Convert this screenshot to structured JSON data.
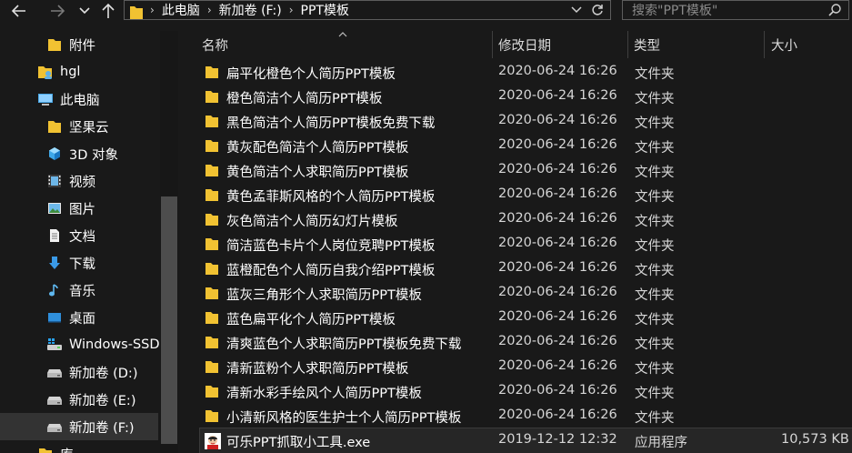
{
  "toolbar": {
    "back_icon": "arrow-left-icon",
    "forward_icon": "arrow-right-icon",
    "recent_icon": "chevron-down-icon",
    "up_icon": "arrow-up-icon",
    "breadcrumbs": [
      "此电脑",
      "新加卷 (F:)",
      "PPT模板"
    ],
    "search_placeholder": "搜索\"PPT模板\""
  },
  "nav": {
    "items": [
      {
        "label": "附件",
        "icon": "folder-icon",
        "pinned": true
      },
      {
        "label": "hgl",
        "icon": "user-folder-icon",
        "pinned": false
      },
      {
        "label": "此电脑",
        "icon": "computer-icon",
        "pinned": false
      },
      {
        "label": "坚果云",
        "icon": "folder-icon",
        "pinned": false
      },
      {
        "label": "3D 对象",
        "icon": "cube-icon",
        "pinned": false
      },
      {
        "label": "视频",
        "icon": "video-icon",
        "pinned": false
      },
      {
        "label": "图片",
        "icon": "picture-icon",
        "pinned": false
      },
      {
        "label": "文档",
        "icon": "document-icon",
        "pinned": false
      },
      {
        "label": "下载",
        "icon": "download-icon",
        "pinned": false
      },
      {
        "label": "音乐",
        "icon": "music-icon",
        "pinned": false
      },
      {
        "label": "桌面",
        "icon": "desktop-icon",
        "pinned": false
      },
      {
        "label": "Windows-SSD",
        "icon": "windows-drive-icon",
        "pinned": false
      },
      {
        "label": "新加卷 (D:)",
        "icon": "drive-icon",
        "pinned": false
      },
      {
        "label": "新加卷 (E:)",
        "icon": "drive-icon",
        "pinned": false
      },
      {
        "label": "新加卷 (F:)",
        "icon": "drive-icon",
        "pinned": false,
        "selected": true
      },
      {
        "label": "库",
        "icon": "folder-icon",
        "pinned": false
      }
    ]
  },
  "columns": {
    "name": "名称",
    "date": "修改日期",
    "type": "类型",
    "size": "大小"
  },
  "files": [
    {
      "name": "扁平化橙色个人简历PPT模板",
      "date": "2020-06-24 16:26",
      "type": "文件夹",
      "size": ""
    },
    {
      "name": "橙色简洁个人简历PPT模板",
      "date": "2020-06-24 16:26",
      "type": "文件夹",
      "size": ""
    },
    {
      "name": "黑色简洁个人简历PPT模板免费下载",
      "date": "2020-06-24 16:26",
      "type": "文件夹",
      "size": ""
    },
    {
      "name": "黄灰配色简洁个人简历PPT模板",
      "date": "2020-06-24 16:26",
      "type": "文件夹",
      "size": ""
    },
    {
      "name": "黄色简洁个人求职简历PPT模板",
      "date": "2020-06-24 16:26",
      "type": "文件夹",
      "size": ""
    },
    {
      "name": "黄色孟菲斯风格的个人简历PPT模板",
      "date": "2020-06-24 16:26",
      "type": "文件夹",
      "size": ""
    },
    {
      "name": "灰色简洁个人简历幻灯片模板",
      "date": "2020-06-24 16:26",
      "type": "文件夹",
      "size": ""
    },
    {
      "name": "简洁蓝色卡片个人岗位竞聘PPT模板",
      "date": "2020-06-24 16:26",
      "type": "文件夹",
      "size": ""
    },
    {
      "name": "蓝橙配色个人简历自我介绍PPT模板",
      "date": "2020-06-24 16:26",
      "type": "文件夹",
      "size": ""
    },
    {
      "name": "蓝灰三角形个人求职简历PPT模板",
      "date": "2020-06-24 16:26",
      "type": "文件夹",
      "size": ""
    },
    {
      "name": "蓝色扁平化个人简历PPT模板",
      "date": "2020-06-24 16:26",
      "type": "文件夹",
      "size": ""
    },
    {
      "name": "清爽蓝色个人求职简历PPT模板免费下载",
      "date": "2020-06-24 16:26",
      "type": "文件夹",
      "size": ""
    },
    {
      "name": "清新蓝粉个人求职简历PPT模板",
      "date": "2020-06-24 16:26",
      "type": "文件夹",
      "size": ""
    },
    {
      "name": "清新水彩手绘风个人简历PPT模板",
      "date": "2020-06-24 16:26",
      "type": "文件夹",
      "size": ""
    },
    {
      "name": "小清新风格的医生护士个人简历PPT模板",
      "date": "2020-06-24 16:26",
      "type": "文件夹",
      "size": ""
    },
    {
      "name": "可乐PPT抓取小工具.exe",
      "date": "2019-12-12 12:32",
      "type": "应用程序",
      "size": "10,573 KB",
      "selected": true
    }
  ],
  "colors": {
    "folder": "#f1c232",
    "background": "#191919",
    "selection": "#333333"
  }
}
